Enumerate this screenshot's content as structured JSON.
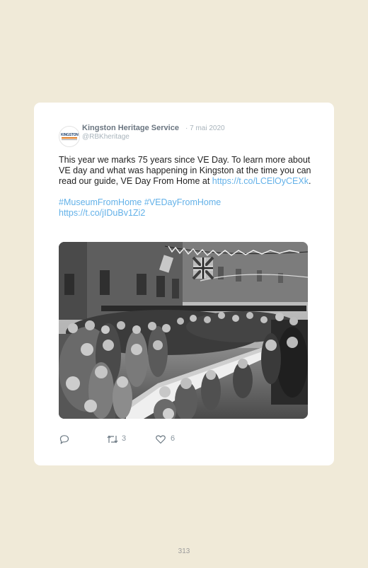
{
  "tweet": {
    "account_name": "Kingston Heritage Service",
    "date": "· 7 mai 2020",
    "handle": "@RBKheritage",
    "avatar_logo": "KINGSTON",
    "text_line1": "This year we marks 75 years since VE Day. To learn more about VE day and what was happening in Kingston at the time you can read our guide, VE Day From Home at",
    "link1": "https://t.co/LCElOyCEXk",
    "link1_trailing": ".",
    "hashtag1": "#MuseumFromHome",
    "hashtag2": "#VEDayFromHome",
    "link2": "https://t.co/jIDuBv1Zi2",
    "photo": "black-and-white-street-party-photo"
  },
  "actions": {
    "reply_icon": "reply-icon",
    "retweet_icon": "retweet-icon",
    "retweet_count": "3",
    "like_icon": "heart-icon",
    "like_count": "6"
  },
  "colors": {
    "page_background": "#f0ead8",
    "card_background": "#ffffff",
    "link": "#63b1e8"
  },
  "page_number": "313"
}
